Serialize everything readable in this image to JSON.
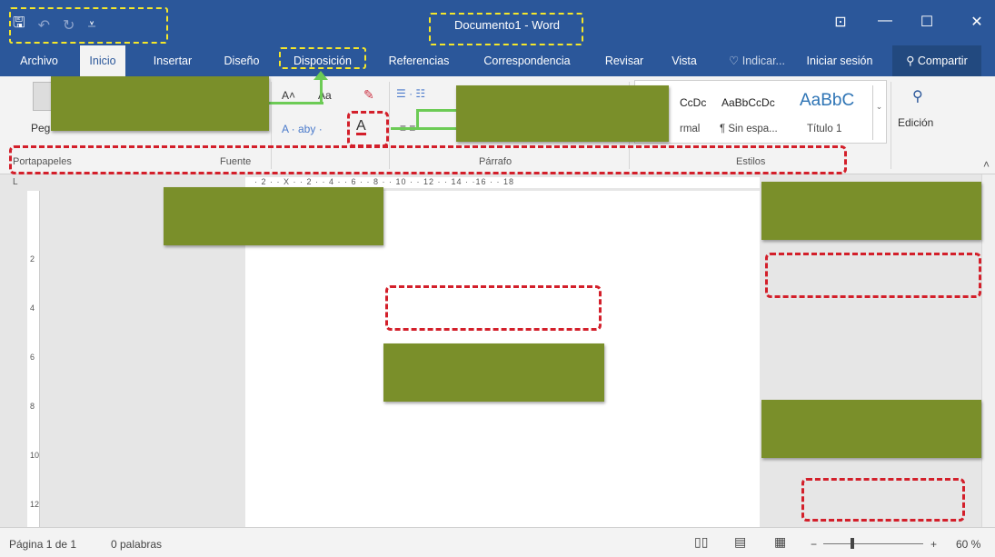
{
  "quick_access": {
    "save_icon": "🖫",
    "undo_icon": "↶",
    "redo_icon": "↻",
    "more_icon": "⩡"
  },
  "window": {
    "title": "Documento1 - Word",
    "ribbon_display_icon": "⊡",
    "minimize_icon": "—",
    "maximize_icon": "☐",
    "close_icon": "✕"
  },
  "tabs": [
    {
      "label": "Archivo"
    },
    {
      "label": "Inicio"
    },
    {
      "label": "Insertar"
    },
    {
      "label": "Diseño"
    },
    {
      "label": "Disposición"
    },
    {
      "label": "Referencias"
    },
    {
      "label": "Correspondencia"
    },
    {
      "label": "Revisar"
    },
    {
      "label": "Vista"
    }
  ],
  "tell_me": {
    "icon": "♡",
    "label": "Indicar..."
  },
  "sign_in": "Iniciar sesión",
  "share": {
    "icon": "⚲",
    "label": "Compartir"
  },
  "ribbon": {
    "paste_label": "Peg",
    "font_grow": "A˄",
    "font_aa": "Aa",
    "font_row2": "A  ·  aby  ·",
    "font_color": "A",
    "para_top": "☰ · ☷",
    "align": "≡  ≡",
    "styles": [
      {
        "sample": "CcDc",
        "label": "rmal"
      },
      {
        "sample": "AaBbCcDc",
        "label": "¶ Sin espa..."
      },
      {
        "sample": "AaBbC",
        "label": "Título 1"
      }
    ],
    "editing_label": "Edición",
    "editing_icon": "⚲",
    "groups": [
      "Portapapeles",
      "Fuente",
      "Párrafo",
      "Estilos"
    ]
  },
  "ruler": {
    "text": "· 2 ·  ·  X  ·  · 2 ·  · 4 ·  · 6 ·  · 8 ·  · 10 ·  · 12 ·  · 14 ·  ·16 ·  · 18",
    "vertical": [
      "2",
      "4",
      "6",
      "8",
      "10",
      "12"
    ]
  },
  "status": {
    "page": "Página 1 de 1",
    "words": "0 palabras",
    "zoom_minus": "−",
    "zoom_plus": "+",
    "zoom": "60 %"
  }
}
